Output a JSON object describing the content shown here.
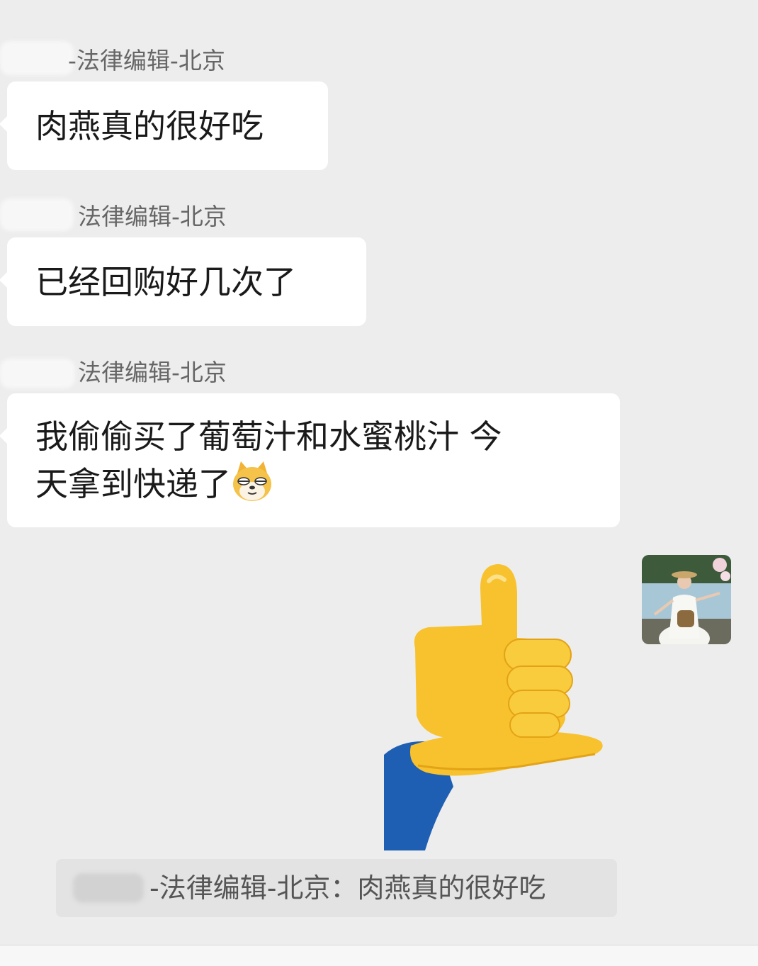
{
  "messages": [
    {
      "sender": "-法律编辑-北京",
      "text": "肉燕真的很好吃"
    },
    {
      "sender": "法律编辑-北京",
      "text": "已经回购好几次了"
    },
    {
      "sender": "法律编辑-北京",
      "text_line1": "我偷偷买了葡萄汁和水蜜桃汁 今",
      "text_line2": "天拿到快递了",
      "emoji": "doge-face-icon"
    }
  ],
  "self_message": {
    "sticker": "thumbs-up-sticker",
    "avatar": "user-avatar-photo"
  },
  "quote": {
    "text": "-法律编辑-北京：肉燕真的很好吃"
  },
  "colors": {
    "background": "#ededed",
    "bubble": "#ffffff",
    "quote_bg": "#e3e3e3",
    "sender_text": "#666666"
  }
}
